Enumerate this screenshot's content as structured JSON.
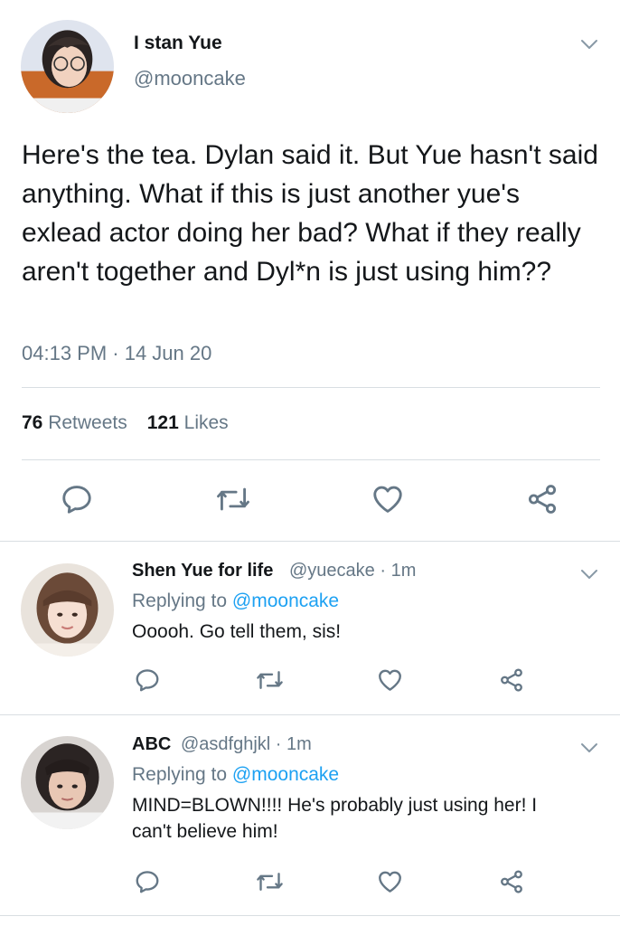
{
  "main_tweet": {
    "display_name": "I stan Yue",
    "handle": "@mooncake",
    "text": "Here's the tea. Dylan said it. But Yue hasn't said anything. What if this is just another yue's exlead actor doing her bad? What if they really aren't together and Dyl*n is just using him??",
    "timestamp": "04:13 PM · 14 Jun 20",
    "retweets_count": "76",
    "retweets_label": "Retweets",
    "likes_count": "121",
    "likes_label": "Likes"
  },
  "replies": [
    {
      "display_name": "Shen Yue for life",
      "handle": "@yuecake · 1m",
      "replying_prefix": "Replying to ",
      "replying_to": "@mooncake",
      "text": "Ooooh. Go tell them, sis!"
    },
    {
      "display_name": "ABC",
      "handle": "@asdfghjkl · 1m",
      "replying_prefix": "Replying to ",
      "replying_to": "@mooncake",
      "text": "MIND=BLOWN!!!! He's probably just using her! I can't believe him!"
    }
  ],
  "icons": {
    "reply": "reply-icon",
    "retweet": "retweet-icon",
    "like": "heart-icon",
    "share": "share-icon",
    "menu": "chevron-down-icon"
  },
  "colors": {
    "text": "#14171a",
    "secondary": "#657786",
    "link": "#1da1f2",
    "divider": "#d9dee2"
  }
}
